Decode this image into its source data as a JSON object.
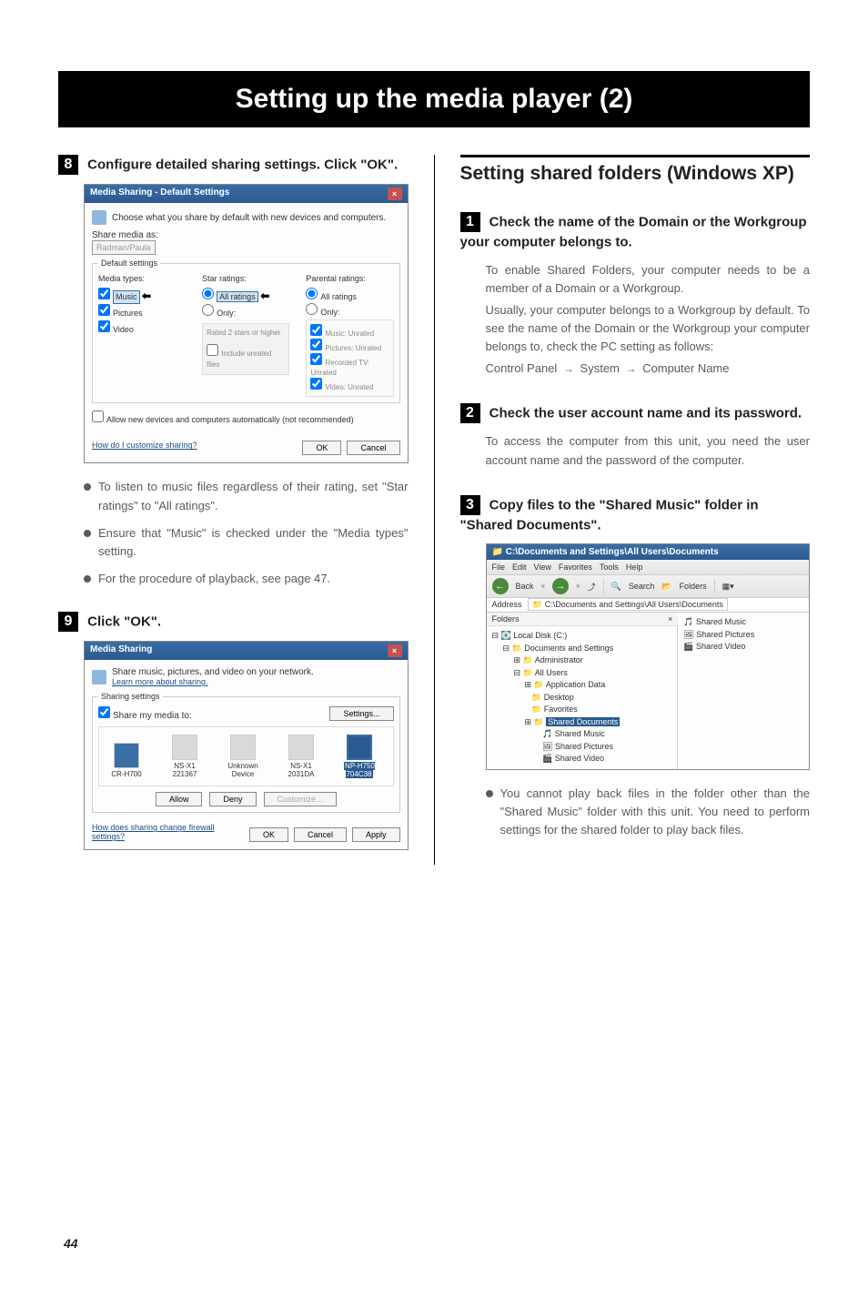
{
  "page_title": "Setting up the media player (2)",
  "page_number": "44",
  "left": {
    "step8_num": "8",
    "step8_title": "Configure detailed sharing settings. Click \"OK\".",
    "ss1": {
      "title": "Media Sharing - Default Settings",
      "desc": "Choose what you share by default with new devices and computers.",
      "share_as_label": "Share media as:",
      "share_as_value": "Radman/Paula",
      "default_settings_legend": "Default settings",
      "media_types_title": "Media types:",
      "media_music": "Music",
      "media_pictures": "Pictures",
      "media_video": "Video",
      "star_title": "Star ratings:",
      "star_all": "All ratings",
      "star_only": "Only:",
      "star_rated": "Rated 2 stars or higher",
      "star_include": "Include unrated files",
      "parental_title": "Parental ratings:",
      "parental_all": "All ratings",
      "parental_only": "Only:",
      "rating_music": "Music: Unrated",
      "rating_pictures": "Pictures: Unrated",
      "rating_tv": "Recorded TV: Unrated",
      "rating_video": "Video: Unrated",
      "allow_new": "Allow new devices and computers automatically (not recommended)",
      "customize_link": "How do I customize sharing?",
      "ok": "OK",
      "cancel": "Cancel"
    },
    "bullet1": "To listen to music files regardless of their rating, set \"Star ratings\" to \"All ratings\".",
    "bullet2": "Ensure that \"Music\" is checked under the \"Media types\" setting.",
    "bullet3": "For the procedure of playback, see page 47.",
    "step9_num": "9",
    "step9_title": "Click \"OK\".",
    "ss2": {
      "title": "Media Sharing",
      "desc": "Share music, pictures, and video on your network.",
      "learn_link": "Learn more about sharing.",
      "sharing_legend": "Sharing settings",
      "share_to": "Share my media to:",
      "settings_btn": "Settings...",
      "dev1": "CR-H700",
      "dev2": "NS-X1 221367",
      "dev3": "Unknown Device",
      "dev4": "NS-X1 2031DA",
      "dev5": "NP-H750 704C38",
      "allow": "Allow",
      "deny": "Deny",
      "customize": "Customize...",
      "firewall_link": "How does sharing change firewall settings?",
      "ok": "OK",
      "cancel": "Cancel",
      "apply": "Apply"
    }
  },
  "right": {
    "section_title": "Setting shared folders (Windows XP)",
    "step1_num": "1",
    "step1_title": "Check the name of the Domain or the Workgroup your computer belongs to.",
    "step1_p1": "To enable Shared Folders, your computer needs to be a member of a Domain or a Workgroup.",
    "step1_p2": "Usually, your computer belongs to a Workgroup by default. To see the name of the Domain or the Workgroup your computer belongs to, check the PC setting as follows:",
    "step1_path_a": "Control Panel",
    "step1_path_b": "System",
    "step1_path_c": "Computer Name",
    "step2_num": "2",
    "step2_title": "Check the user account name and its password.",
    "step2_p1": "To access the computer from this unit, you need the user account name and the password of the computer.",
    "step3_num": "3",
    "step3_title": "Copy files to the \"Shared Music\" folder in \"Shared Documents\".",
    "ss3": {
      "title": "C:\\Documents and Settings\\All Users\\Documents",
      "menu_file": "File",
      "menu_edit": "Edit",
      "menu_view": "View",
      "menu_fav": "Favorites",
      "menu_tools": "Tools",
      "menu_help": "Help",
      "back": "Back",
      "search": "Search",
      "folders_btn": "Folders",
      "address_label": "Address",
      "address_path": "C:\\Documents and Settings\\All Users\\Documents",
      "folders_header": "Folders",
      "tree_local": "Local Disk (C:)",
      "tree_docset": "Documents and Settings",
      "tree_admin": "Administrator",
      "tree_allusers": "All Users",
      "tree_appdata": "Application Data",
      "tree_desktop": "Desktop",
      "tree_fav": "Favorites",
      "tree_shared_docs": "Shared Documents",
      "tree_shared_music": "Shared Music",
      "tree_shared_pics": "Shared Pictures",
      "tree_shared_video": "Shared Video",
      "item_music": "Shared Music",
      "item_pics": "Shared Pictures",
      "item_video": "Shared Video"
    },
    "bullet1": "You cannot play back files in the folder other than the \"Shared Music\" folder with this unit. You need to perform settings for the shared folder to play back files."
  }
}
